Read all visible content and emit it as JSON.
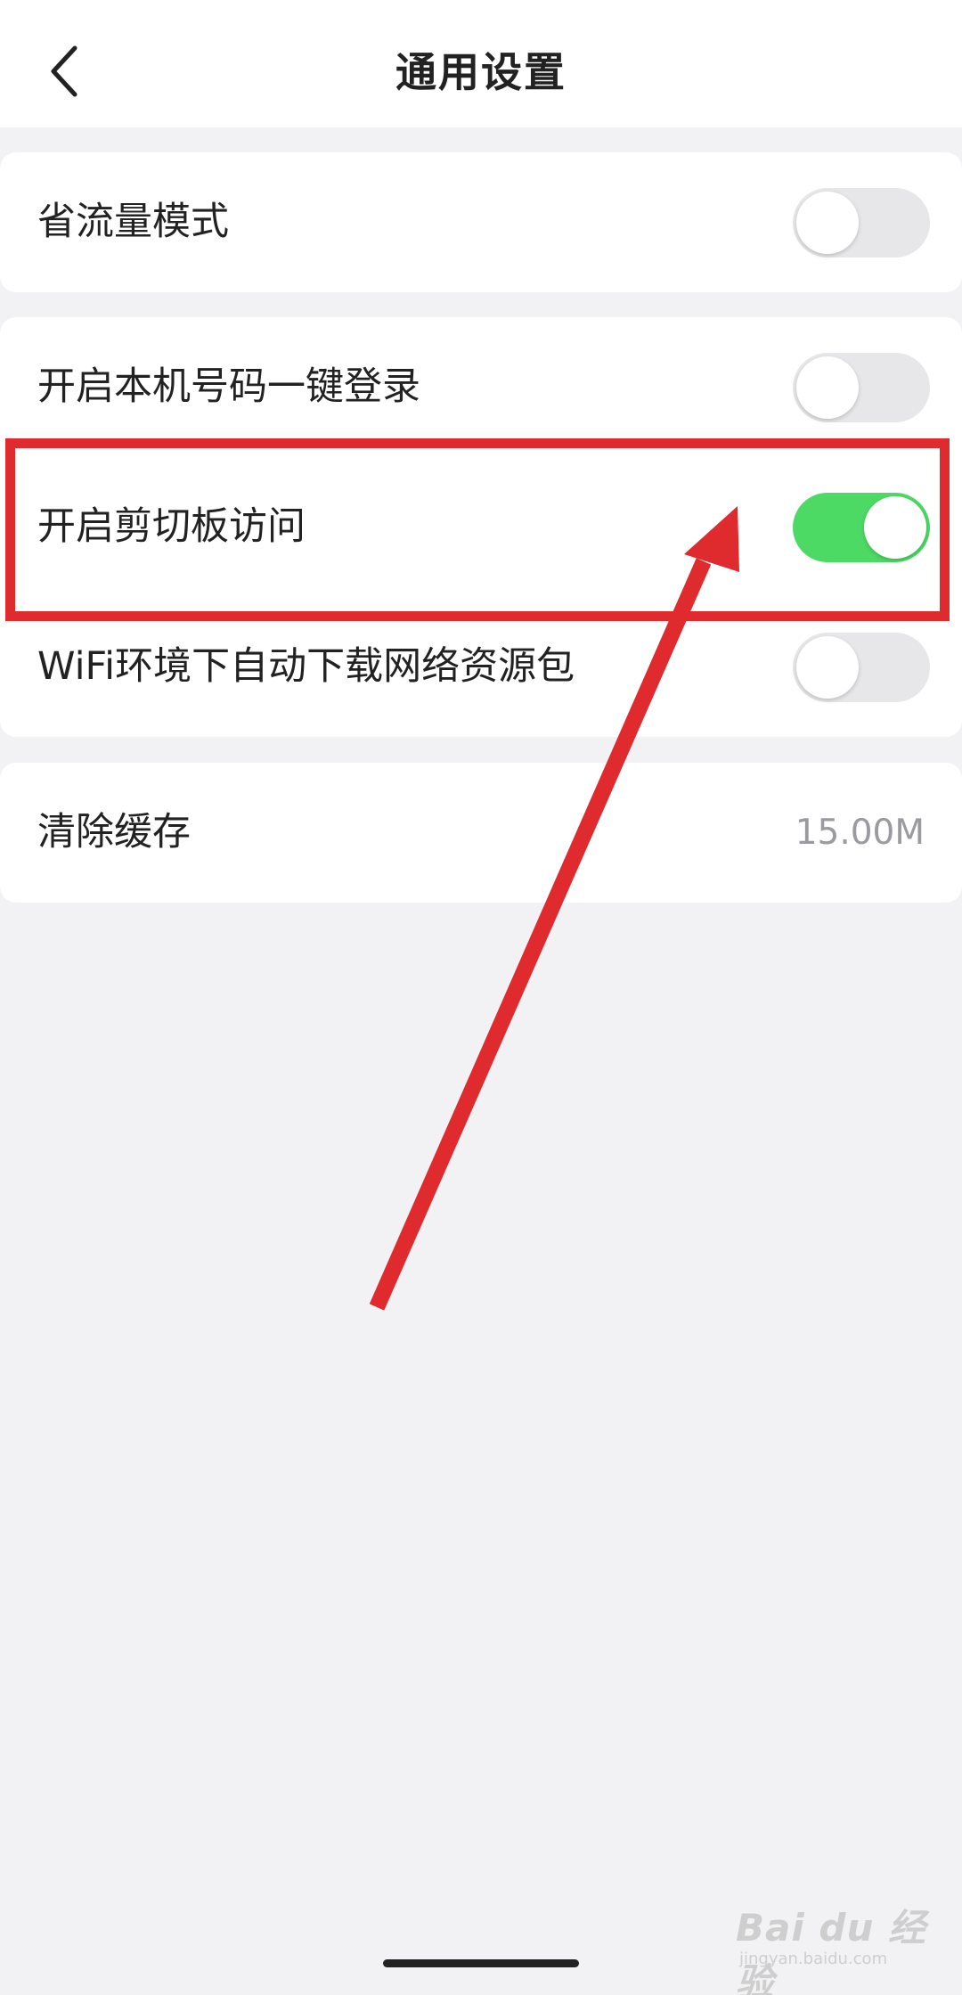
{
  "header": {
    "title": "通用设置",
    "back_icon": "chevron-left-icon"
  },
  "sections": [
    {
      "items": [
        {
          "label": "省流量模式",
          "control": "switch",
          "on": false
        }
      ]
    },
    {
      "items": [
        {
          "label": "开启本机号码一键登录",
          "control": "switch",
          "on": false
        },
        {
          "label": "开启剪切板访问",
          "control": "switch",
          "on": true
        },
        {
          "label": "WiFi环境下自动下载网络资源包",
          "control": "switch",
          "on": false
        }
      ]
    },
    {
      "items": [
        {
          "label": "清除缓存",
          "control": "value",
          "value": "15.00M"
        }
      ]
    }
  ],
  "annotation": {
    "highlight_color": "#e02b2e",
    "highlighted_item": "开启剪切板访问"
  },
  "watermark": {
    "brand": "Bai du 经验",
    "url": "jingyan.baidu.com"
  },
  "colors": {
    "switch_on": "#4cd964",
    "switch_off": "#e7e7ea",
    "background": "#f2f2f4"
  }
}
